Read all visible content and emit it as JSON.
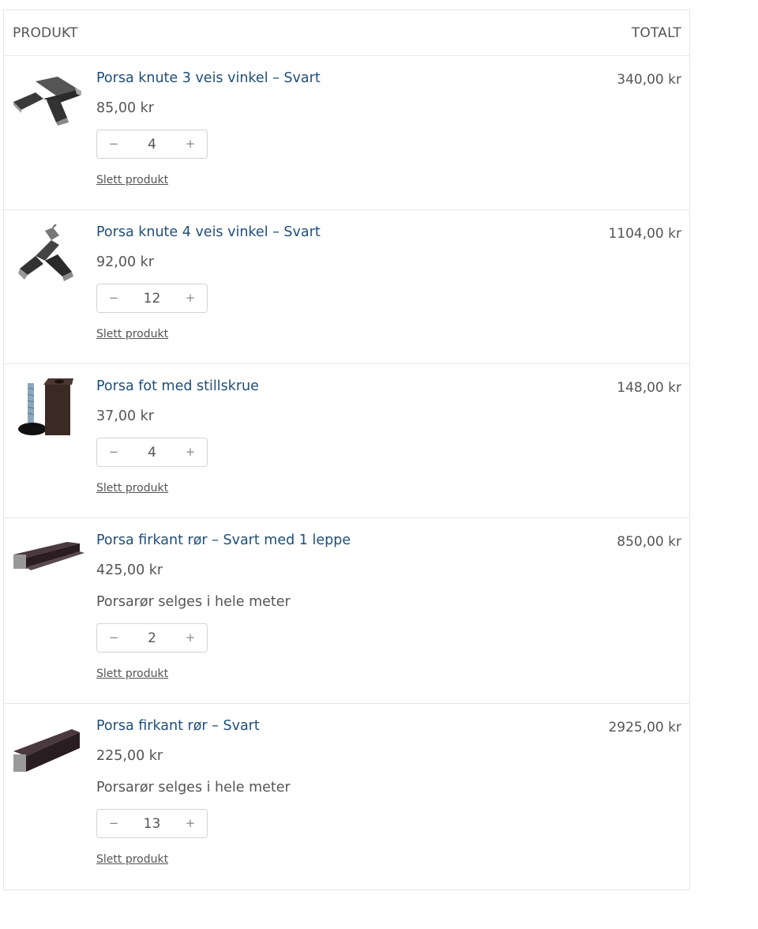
{
  "header": {
    "product": "PRODUKT",
    "total": "TOTALT"
  },
  "items": [
    {
      "name": "Porsa knute 3 veis vinkel – Svart",
      "price": "85,00 kr",
      "qty": "4",
      "total": "340,00 kr",
      "remove": "Slett produkt",
      "icon": "corner-connector-3way-icon"
    },
    {
      "name": "Porsa knute 4 veis vinkel – Svart",
      "price": "92,00 kr",
      "qty": "12",
      "total": "1104,00 kr",
      "remove": "Slett produkt",
      "icon": "corner-connector-4way-icon"
    },
    {
      "name": "Porsa fot med stillskrue",
      "price": "37,00 kr",
      "qty": "4",
      "total": "148,00 kr",
      "remove": "Slett produkt",
      "icon": "adjustable-foot-icon"
    },
    {
      "name": "Porsa firkant rør – Svart med 1 leppe",
      "price": "425,00 kr",
      "note": "Porsarør selges i hele meter",
      "qty": "2",
      "total": "850,00 kr",
      "remove": "Slett produkt",
      "icon": "square-tube-lip-icon"
    },
    {
      "name": "Porsa firkant rør – Svart",
      "price": "225,00 kr",
      "note": "Porsarør selges i hele meter",
      "qty": "13",
      "total": "2925,00 kr",
      "remove": "Slett produkt",
      "icon": "square-tube-icon"
    }
  ],
  "qty_controls": {
    "minus": "−",
    "plus": "+"
  },
  "colors": {
    "link": "#1f4e79",
    "text": "#555555",
    "border": "#e6e6e6"
  }
}
